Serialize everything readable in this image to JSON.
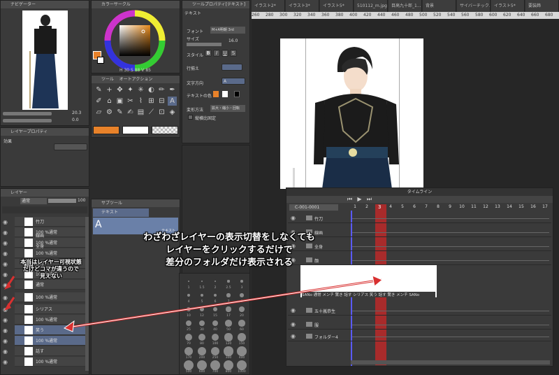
{
  "navigator": {
    "title": "ナビゲーター",
    "zoom": "20.3",
    "rotate": "0.0"
  },
  "color_circle": {
    "title": "カラーサークル",
    "hsv": [
      "H",
      "S",
      "V"
    ],
    "values": [
      "30",
      "88",
      "85"
    ],
    "accent": "#e8822a"
  },
  "tool_panel": {
    "tab1": "ツール",
    "tab2": "オートアクション"
  },
  "tool_property": {
    "title": "ツールプロパティ[テキスト]",
    "tool_name": "テキスト",
    "font_label": "フォント",
    "font_value": "M+A明朝 3rd",
    "size_label": "サイズ",
    "size_value": "16.0",
    "style_label": "スタイル",
    "align_label": "行揃え",
    "direction_label": "文字方向",
    "direction_value": "A",
    "textcolor_label": "テキストの色",
    "transform_label": "変形方法",
    "transform_value": "拡大・縮小・回転",
    "fixaspect_label": "縦横比固定"
  },
  "layer_property": {
    "title": "レイヤープロパティ",
    "effect": "効果"
  },
  "layer_panel": {
    "tab1": "レイヤー",
    "tab2": "レイヤー",
    "blend": "通常",
    "opacity": "100",
    "rows": [
      {
        "name": "竹刀"
      },
      {
        "name": "100 %通常",
        "sub": "線画"
      },
      {
        "name": "100 %通常",
        "sub": "全身"
      },
      {
        "name": "100 %通常"
      },
      {
        "name": "顔付"
      },
      {
        "name": "100 %通常"
      },
      {
        "name": "通常"
      },
      {
        "name": "100 %通常"
      },
      {
        "name": "シリアス"
      },
      {
        "name": "100 %通常"
      },
      {
        "name": "笑う"
      },
      {
        "name": "100 %通常"
      },
      {
        "name": "話す"
      },
      {
        "name": "100 %通常"
      }
    ]
  },
  "subtool": {
    "title": "サブツール",
    "item": "テキスト",
    "tool_char": "A",
    "tag": "テキスト"
  },
  "brush_sizes": [
    "1",
    "1.5",
    "2",
    "2.5",
    "3",
    "4",
    "5",
    "6",
    "7",
    "8",
    "10",
    "12",
    "15",
    "17",
    "20",
    "25",
    "30",
    "40",
    "50",
    "60",
    "70",
    "80",
    "100",
    "120",
    "150",
    "170",
    "200",
    "250",
    "300",
    "400",
    "500",
    "600",
    "700",
    "800",
    "1000"
  ],
  "tabs": [
    "イラスト2*",
    "イラスト3*",
    "イラスト5*",
    "510112_m.jpg*",
    "目高九十郎_1...",
    "背景",
    "サイバーチック.jpg*",
    "イラスト5*",
    "要装飾"
  ],
  "ruler": [
    "260",
    "280",
    "300",
    "320",
    "340",
    "360",
    "380",
    "400",
    "420",
    "440",
    "460",
    "480",
    "500",
    "520",
    "540",
    "560",
    "580",
    "600",
    "620",
    "640",
    "660",
    "680"
  ],
  "timeline": {
    "title": "タイムライン",
    "track": "C-001-0001",
    "frames": [
      "1",
      "2",
      "3",
      "4",
      "5",
      "6",
      "7",
      "8",
      "9",
      "10",
      "11",
      "12",
      "13",
      "14",
      "15",
      "16",
      "17"
    ],
    "current_frame": "3",
    "rows": [
      "竹刀",
      "線画",
      "全身",
      "顔",
      "五十嵐恭生",
      "服",
      "フォルダー4"
    ],
    "cel_labels": "SANo 通常 メンチ 驚き 話す シリアス 笑う 話す 驚き メンチ SANo"
  },
  "annotations": {
    "main_line1": "わざわざレイヤーの表示切替をしなくても",
    "main_line2": "レイヤーをクリックするだけで",
    "main_line3": "差分のフォルダだけ表示される",
    "note_line1": "本当はレイヤー可視状態",
    "note_line2": "だけどコマが違うので",
    "note_line3": "見えない"
  }
}
